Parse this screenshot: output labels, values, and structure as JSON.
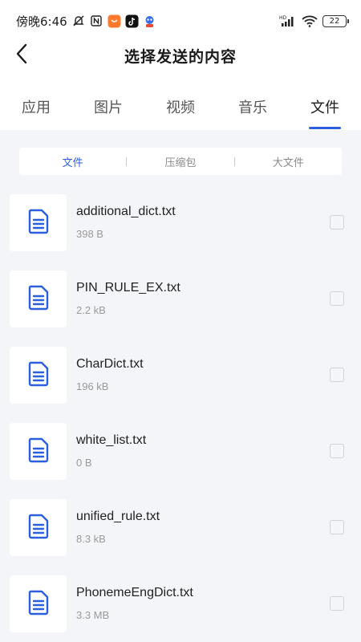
{
  "status_bar": {
    "carrier_time": "傍晚6:46",
    "network_label": "HD",
    "battery": "22",
    "left_icons": [
      "mute-bell-icon",
      "nfc-icon",
      "app-orange-icon",
      "tiktok-icon",
      "mascot-icon"
    ],
    "right_icons": [
      "signal-icon",
      "wifi-icon",
      "battery-icon"
    ]
  },
  "header": {
    "title": "选择发送的内容",
    "back_icon": "chevron-left-icon"
  },
  "tabs": [
    {
      "label": "应用",
      "active": false
    },
    {
      "label": "图片",
      "active": false
    },
    {
      "label": "视频",
      "active": false
    },
    {
      "label": "音乐",
      "active": false
    },
    {
      "label": "文件",
      "active": true
    }
  ],
  "subtabs": [
    {
      "label": "文件",
      "active": true
    },
    {
      "label": "压缩包",
      "active": false
    },
    {
      "label": "大文件",
      "active": false
    }
  ],
  "files": [
    {
      "name": "additional_dict.txt",
      "size": "398 B",
      "icon": "document-icon",
      "checked": false
    },
    {
      "name": "PIN_RULE_EX.txt",
      "size": "2.2 kB",
      "icon": "document-icon",
      "checked": false
    },
    {
      "name": "CharDict.txt",
      "size": "196 kB",
      "icon": "document-icon",
      "checked": false
    },
    {
      "name": "white_list.txt",
      "size": "0 B",
      "icon": "document-icon",
      "checked": false
    },
    {
      "name": "unified_rule.txt",
      "size": "8.3 kB",
      "icon": "document-icon",
      "checked": false
    },
    {
      "name": "PhonemeEngDict.txt",
      "size": "3.3 MB",
      "icon": "document-icon",
      "checked": false
    }
  ],
  "colors": {
    "accent": "#2c5fe0",
    "background": "#f4f5f8",
    "text_primary": "#222222",
    "text_secondary": "#9a9a9a"
  }
}
